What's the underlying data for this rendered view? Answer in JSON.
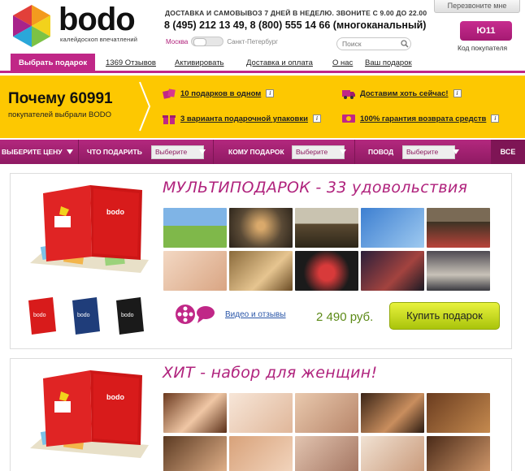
{
  "header": {
    "logo_word": "bodo",
    "logo_tagline": "калейдоскоп впечатлений",
    "delivery": "ДОСТАВКА И САМОВЫВОЗ 7 ДНЕЙ В НЕДЕЛЮ. ЗВОНИТЕ С 9.00 ДО 22.00",
    "phones": "8 (495) 212 13 49, 8 (800) 555 14 66 (многоканальный)",
    "city_active": "Москва",
    "city_inactive": "Санкт-Петербург",
    "search_placeholder": "Поиск",
    "callback_label": "Перезвоните мне",
    "customer_code": "Ю11",
    "customer_code_label": "Код покупателя"
  },
  "nav": {
    "items": [
      {
        "label": "Выбрать подарок"
      },
      {
        "label": "1369 Отзывов"
      },
      {
        "label": "Активировать"
      },
      {
        "label": "Доставка и оплата"
      },
      {
        "label": "О нас"
      },
      {
        "label": "Ваш подарок"
      }
    ]
  },
  "banner": {
    "why": "Почему 60991",
    "sub": "покупателей выбрали BODO",
    "benefits": [
      {
        "text": "10 подарков в одном",
        "icon": "gifts-icon"
      },
      {
        "text": "3 варианта подарочной упаковки",
        "icon": "gift-box-icon"
      },
      {
        "text": "Доставим хоть сейчас!",
        "icon": "truck-icon"
      },
      {
        "text": "100% гарантия возврата средств",
        "icon": "money-back-icon"
      }
    ]
  },
  "filter": {
    "price_label": "ВЫБЕРИТЕ ЦЕНУ",
    "what_label": "ЧТО ПОДАРИТЬ",
    "what_value": "Выберите",
    "whom_label": "КОМУ ПОДАРОК",
    "whom_value": "Выберите",
    "occasion_label": "ПОВОД",
    "occasion_value": "Выберите",
    "all_label": "ВСЕ"
  },
  "products": [
    {
      "title": "МУЛЬТИПОДАРОК - 33 удовольствия",
      "video_link": "Видео и отзывы",
      "price": "2 490 руб.",
      "buy_label": "Купить подарок"
    },
    {
      "title": "ХИТ - набор для женщин!"
    }
  ],
  "colors": {
    "brand_magenta": "#c02787",
    "banner_yellow": "#fdc801",
    "price_green": "#5c8a17",
    "buy_button": "#c4dc1f"
  }
}
